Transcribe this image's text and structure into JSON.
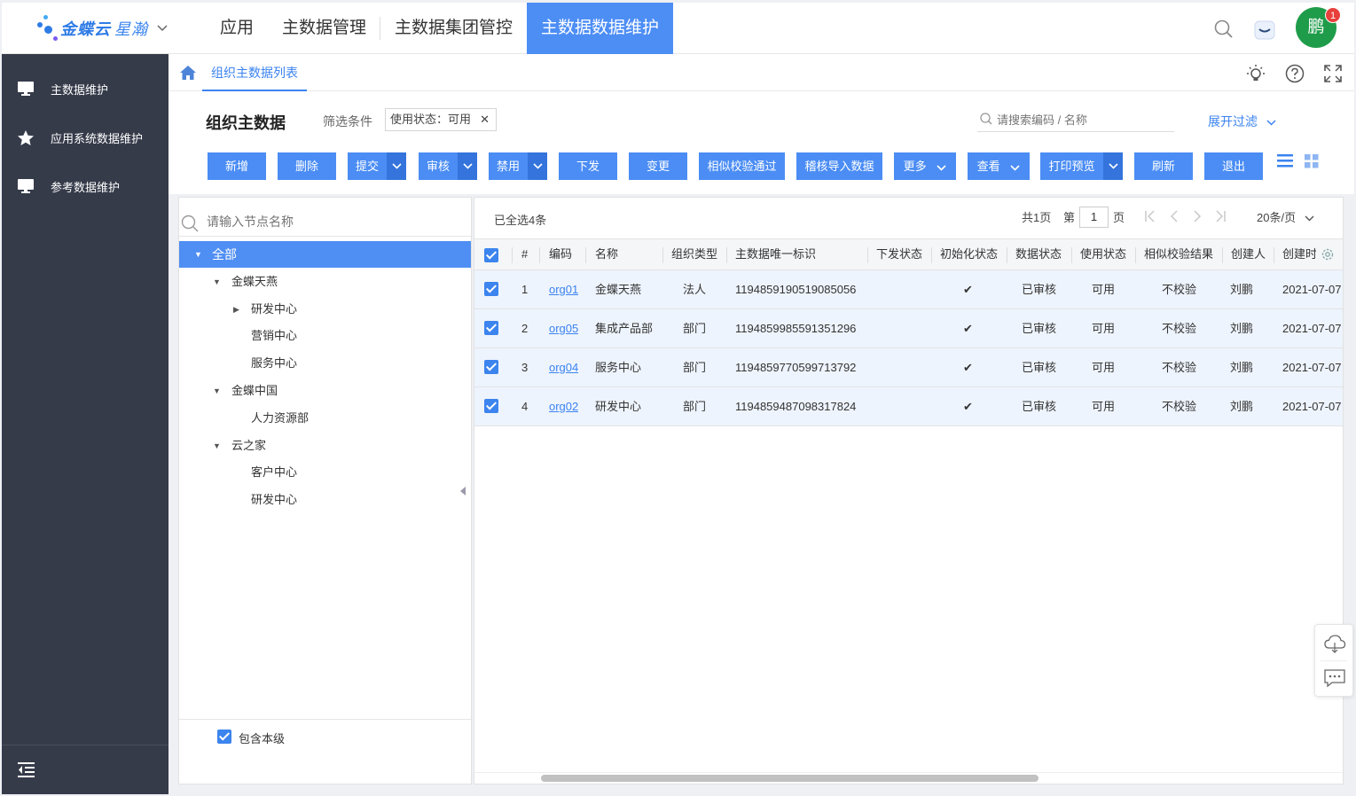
{
  "app": {
    "logo_text": "金蝶云",
    "logo_text2": "星瀚",
    "avatar_text": "鹏",
    "notification_count": "1"
  },
  "topnav": {
    "items": [
      "应用",
      "主数据管理",
      "主数据集团管控",
      "主数据数据维护"
    ],
    "active_index": 3
  },
  "sidebar": {
    "items": [
      {
        "label": "主数据维护",
        "icon": "monitor-icon"
      },
      {
        "label": "应用系统数据维护",
        "icon": "star-icon"
      },
      {
        "label": "参考数据维护",
        "icon": "monitor-icon"
      }
    ]
  },
  "breadcrumb": {
    "tab": "组织主数据列表"
  },
  "header": {
    "title": "组织主数据",
    "filter_label": "筛选条件",
    "filter_chip": "使用状态：可用",
    "search_placeholder": "请搜索编码 / 名称",
    "expand_filter": "展开过滤"
  },
  "toolbar": {
    "buttons": [
      "新增",
      "删除",
      "提交",
      "审核",
      "禁用",
      "下发",
      "变更",
      "相似校验通过",
      "稽核导入数据",
      "更多",
      "查看",
      "打印预览",
      "刷新",
      "退出"
    ]
  },
  "tree": {
    "search_placeholder": "请输入节点名称",
    "nodes": [
      {
        "label": "全部",
        "expanded": true,
        "selected": true
      },
      {
        "label": "金蝶天燕",
        "expanded": true
      },
      {
        "label": "研发中心",
        "expanded": false
      },
      {
        "label": "营销中心"
      },
      {
        "label": "服务中心"
      },
      {
        "label": "金蝶中国",
        "expanded": true
      },
      {
        "label": "人力资源部"
      },
      {
        "label": "云之家",
        "expanded": true
      },
      {
        "label": "客户中心"
      },
      {
        "label": "研发中心"
      }
    ],
    "include_self_label": "包含本级",
    "include_self_checked": true
  },
  "grid": {
    "selected_summary": "已全选4条",
    "pager": {
      "total_pages": "共1页",
      "page_prefix": "第",
      "current_page": "1",
      "page_suffix": "页",
      "page_size": "20条/页"
    },
    "columns": [
      "#",
      "编码",
      "名称",
      "组织类型",
      "主数据唯一标识",
      "下发状态",
      "初始化状态",
      "数据状态",
      "使用状态",
      "相似校验结果",
      "创建人",
      "创建时"
    ],
    "rows": [
      {
        "no": "1",
        "code": "org01",
        "name": "金蝶天燕",
        "type": "法人",
        "uid": "1194859190519085056",
        "dispatch": "",
        "init": "✔",
        "data_status": "已审核",
        "use_status": "可用",
        "similar": "不校验",
        "creator": "刘鹏",
        "created": "2021-07-07"
      },
      {
        "no": "2",
        "code": "org05",
        "name": "集成产品部",
        "type": "部门",
        "uid": "1194859985591351296",
        "dispatch": "",
        "init": "✔",
        "data_status": "已审核",
        "use_status": "可用",
        "similar": "不校验",
        "creator": "刘鹏",
        "created": "2021-07-07"
      },
      {
        "no": "3",
        "code": "org04",
        "name": "服务中心",
        "type": "部门",
        "uid": "1194859770599713792",
        "dispatch": "",
        "init": "✔",
        "data_status": "已审核",
        "use_status": "可用",
        "similar": "不校验",
        "creator": "刘鹏",
        "created": "2021-07-07"
      },
      {
        "no": "4",
        "code": "org02",
        "name": "研发中心",
        "type": "部门",
        "uid": "1194859487098317824",
        "dispatch": "",
        "init": "✔",
        "data_status": "已审核",
        "use_status": "可用",
        "similar": "不校验",
        "creator": "刘鹏",
        "created": "2021-07-07"
      }
    ]
  },
  "colors": {
    "primary": "#4b8df4",
    "sidebar_bg": "#363b4a",
    "row_selected_bg": "#eef4fd",
    "success": "#1f9c4a"
  }
}
